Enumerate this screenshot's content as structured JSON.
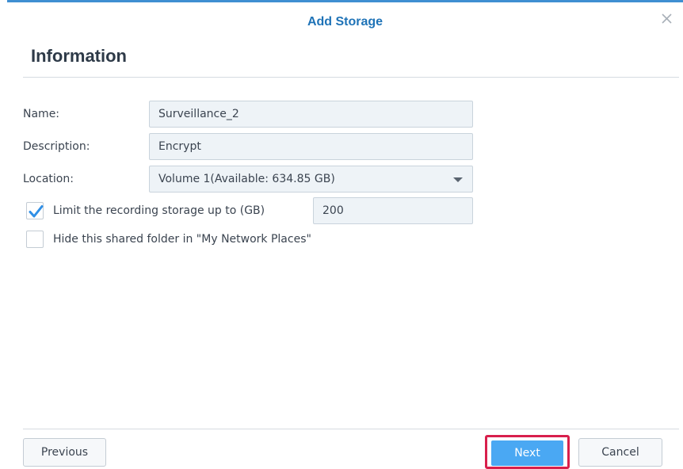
{
  "dialog": {
    "title": "Add Storage",
    "close_icon": "close-icon",
    "accent_color": "#3f8fd2"
  },
  "section": {
    "title": "Information"
  },
  "form": {
    "name": {
      "label": "Name:",
      "value": "Surveillance_2"
    },
    "description": {
      "label": "Description:",
      "value": "Encrypt"
    },
    "location": {
      "label": "Location:",
      "value": "Volume 1(Available: 634.85 GB)",
      "icon": "chevron-down-icon"
    },
    "limit_storage": {
      "label": "Limit the recording storage up to (GB)",
      "checked": true,
      "value": "200"
    },
    "hide_folder": {
      "label": "Hide this shared folder in \"My Network Places\"",
      "checked": false
    }
  },
  "footer": {
    "previous_label": "Previous",
    "next_label": "Next",
    "cancel_label": "Cancel",
    "next_color": "#4aa8f3",
    "highlight_color": "#d81f4c"
  }
}
